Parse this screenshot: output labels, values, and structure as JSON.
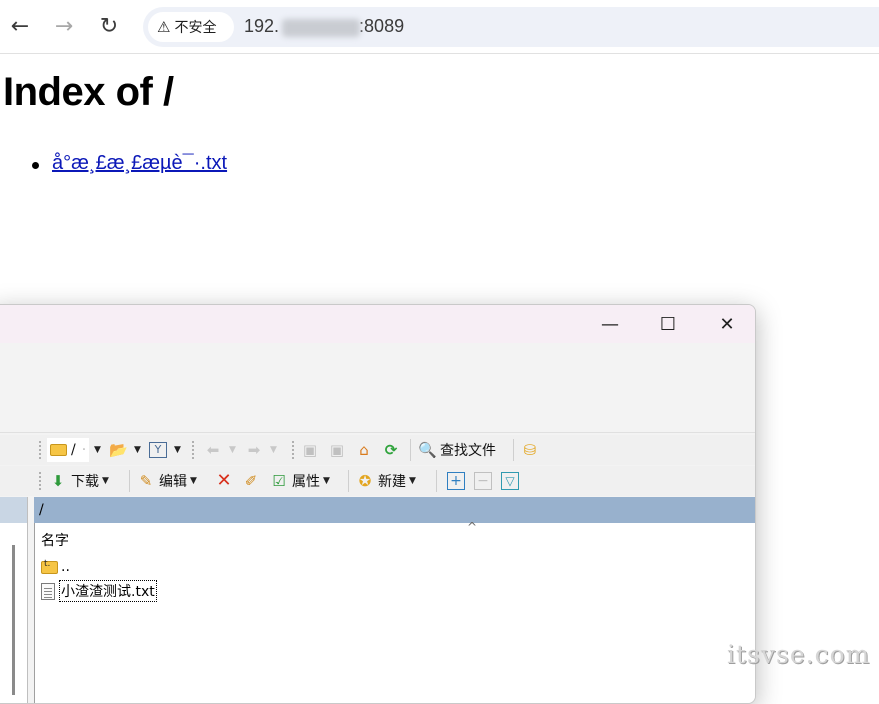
{
  "browser": {
    "nav": {
      "back": "←",
      "forward": "→",
      "reload": "↻"
    },
    "security_label": "不安全",
    "security_icon": "warning-triangle-icon",
    "url_prefix": "192.",
    "url_suffix": ":8089"
  },
  "page": {
    "title": "Index of /",
    "files": [
      {
        "label": "å°æ¸£æ¸£æµè¯·.txt"
      }
    ]
  },
  "ftp": {
    "window_controls": {
      "minimize": "—",
      "maximize": "☐",
      "close": "✕"
    },
    "toolbar1": {
      "path_value": "/",
      "find_files_label": "查找文件"
    },
    "toolbar2": {
      "download_label": "下载",
      "edit_label": "编辑",
      "properties_label": "属性",
      "new_label": "新建"
    },
    "path_bar": "/",
    "column_name": "名字",
    "entries": [
      {
        "name": ".."
      },
      {
        "name": "小渣渣测试.txt"
      }
    ]
  },
  "watermark": "itsvse.com"
}
